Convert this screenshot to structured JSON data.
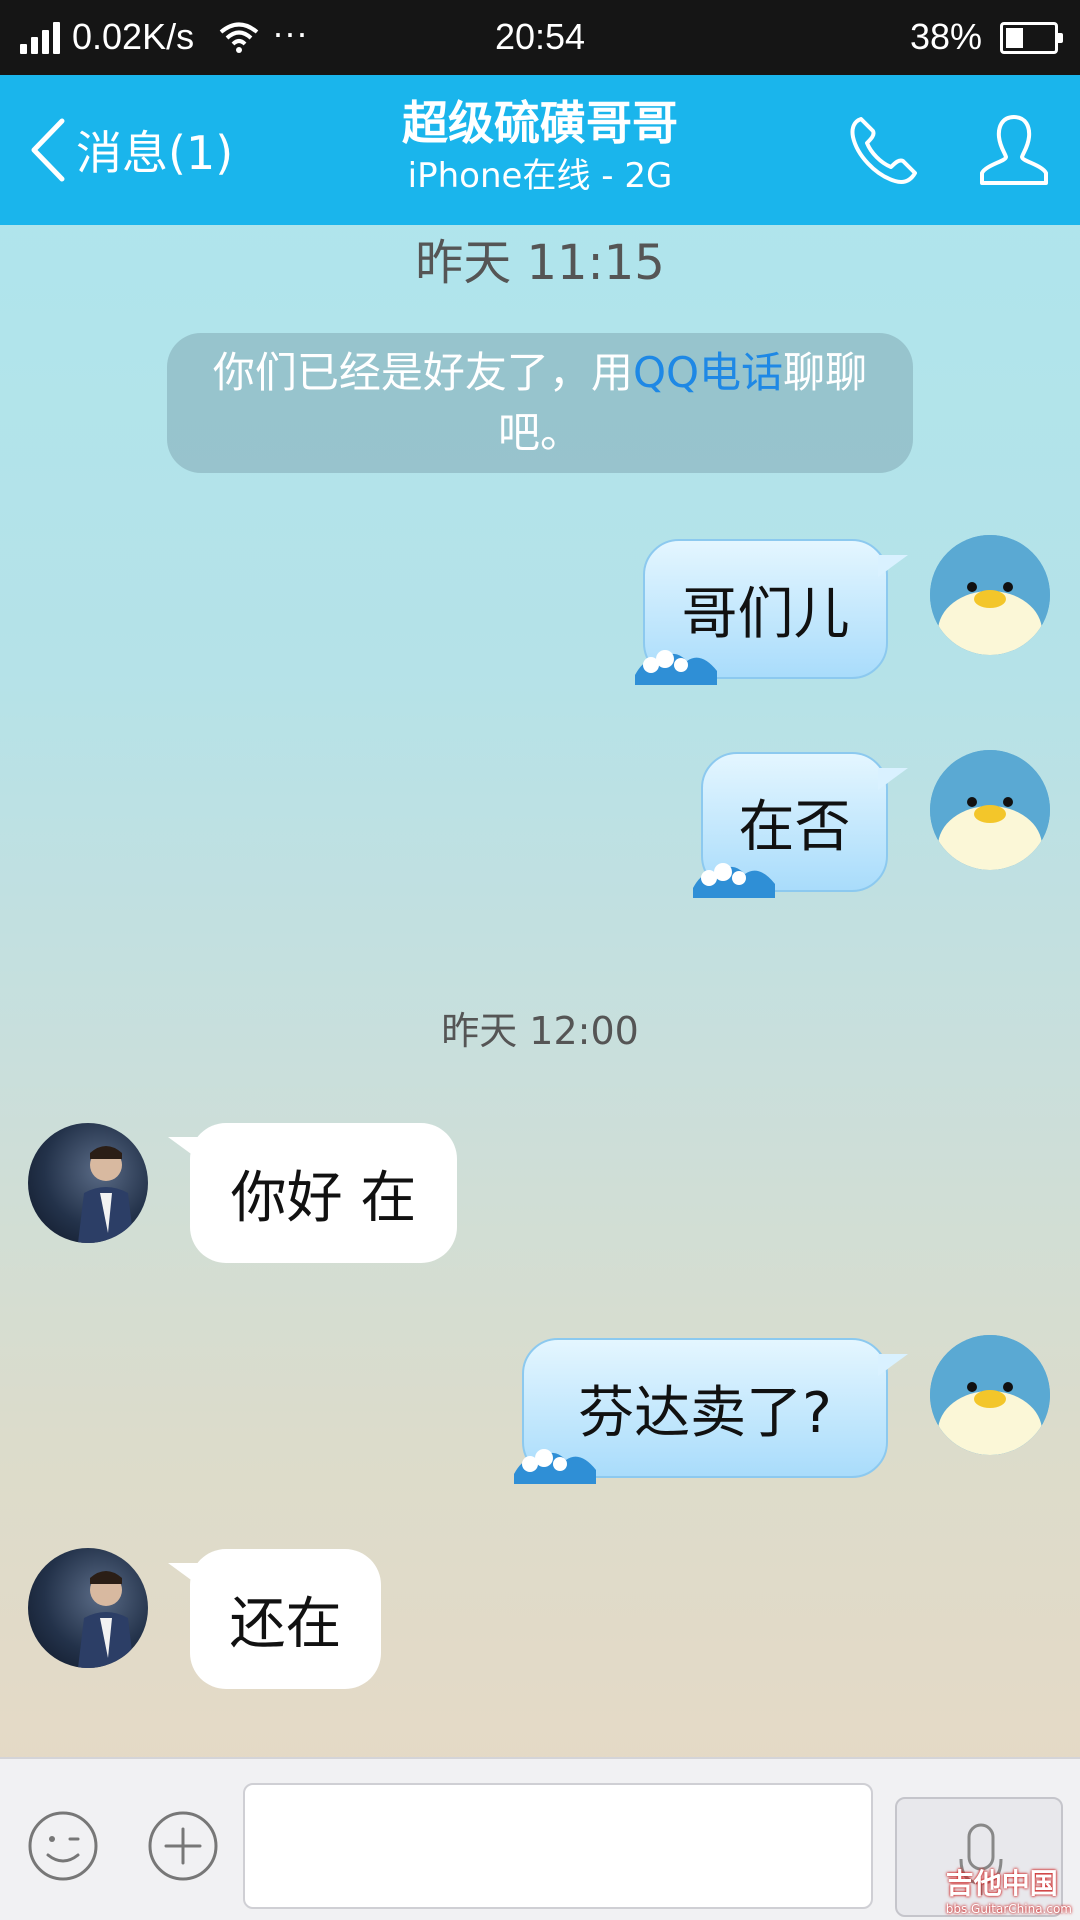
{
  "status_bar": {
    "network_speed": "0.02K/s",
    "more": "···",
    "time": "20:54",
    "battery_percent": "38%",
    "battery_level": 0.38
  },
  "header": {
    "back_label": "消息(1)",
    "contact_name": "超级硫磺哥哥",
    "contact_status": "iPhone在线 - 2G"
  },
  "chat": {
    "timestamp_1": "昨天 11:15",
    "system_notice": {
      "before": "你们已经是好友了，用",
      "link": "QQ电话",
      "after": "聊聊吧。"
    },
    "messages": [
      {
        "from": "me",
        "text": "哥们儿"
      },
      {
        "from": "me",
        "text": "在否"
      },
      {
        "from": "friend",
        "text": "你好 在"
      },
      {
        "from": "me",
        "text": "芬达卖了?"
      },
      {
        "from": "friend",
        "text": "还在"
      }
    ],
    "timestamp_2": "昨天 12:00"
  },
  "input_bar": {
    "text_value": "",
    "placeholder": ""
  },
  "watermark": {
    "text": "吉他中国",
    "url": "bbs.GuitarChina.com"
  },
  "colors": {
    "header_bg": "#1ab5ec",
    "link": "#1e88e5",
    "status_bar_bg": "#151515"
  }
}
